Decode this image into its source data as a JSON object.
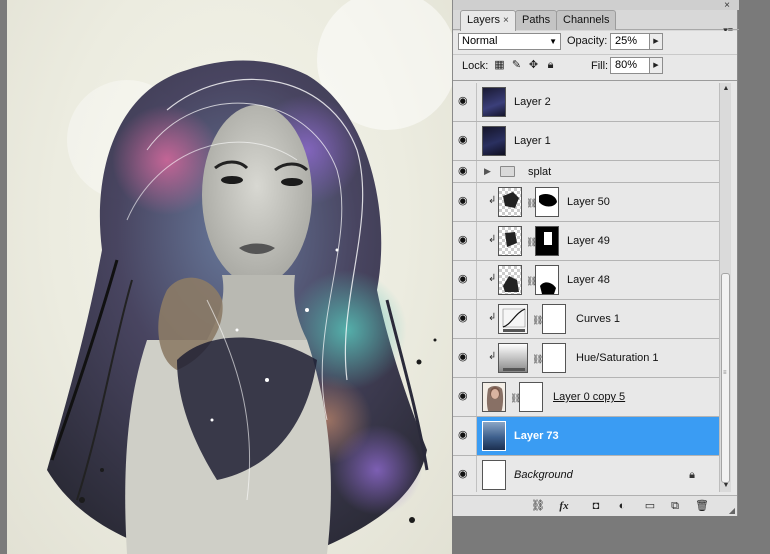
{
  "panel": {
    "tabs": [
      {
        "label": "Layers",
        "active": true
      },
      {
        "label": "Paths",
        "active": false
      },
      {
        "label": "Channels",
        "active": false
      }
    ],
    "close_glyph": "×",
    "menu_glyph": "▾≡",
    "blend_mode": "Normal",
    "opacity_label": "Opacity:",
    "opacity_value": "25%",
    "lock_label": "Lock:",
    "fill_label": "Fill:",
    "fill_value": "80%"
  },
  "layers": [
    {
      "name": "Layer 2",
      "type": "pixel",
      "visible": true
    },
    {
      "name": "Layer 1",
      "type": "pixel",
      "visible": true
    },
    {
      "name": "splat",
      "type": "group",
      "visible": true,
      "collapsed": true
    },
    {
      "name": "Layer 50",
      "type": "masked-clipped",
      "visible": true
    },
    {
      "name": "Layer 49",
      "type": "masked-clipped",
      "visible": true
    },
    {
      "name": "Layer 48",
      "type": "masked-clipped",
      "visible": true
    },
    {
      "name": "Curves 1",
      "type": "adjustment-clipped",
      "visible": true
    },
    {
      "name": "Hue/Saturation 1",
      "type": "adjustment-clipped",
      "visible": true
    },
    {
      "name": "Layer 0 copy 5",
      "type": "smart-masked",
      "visible": true
    },
    {
      "name": "Layer 73",
      "type": "pixel",
      "visible": true,
      "selected": true
    },
    {
      "name": "Background",
      "type": "background",
      "visible": true,
      "locked": true
    }
  ],
  "colors": {
    "selected_row": "#3a9cf3",
    "panel_bg": "#e8e8e8",
    "canvas_bg": "#ecece0"
  },
  "icons": {
    "eye": "eye-icon",
    "link": "link-icon",
    "fx": "fx-icon",
    "mask": "add-mask-icon",
    "adjust": "adjustment-layer-icon",
    "folder": "new-group-icon",
    "new": "new-layer-icon",
    "trash": "trash-icon"
  }
}
